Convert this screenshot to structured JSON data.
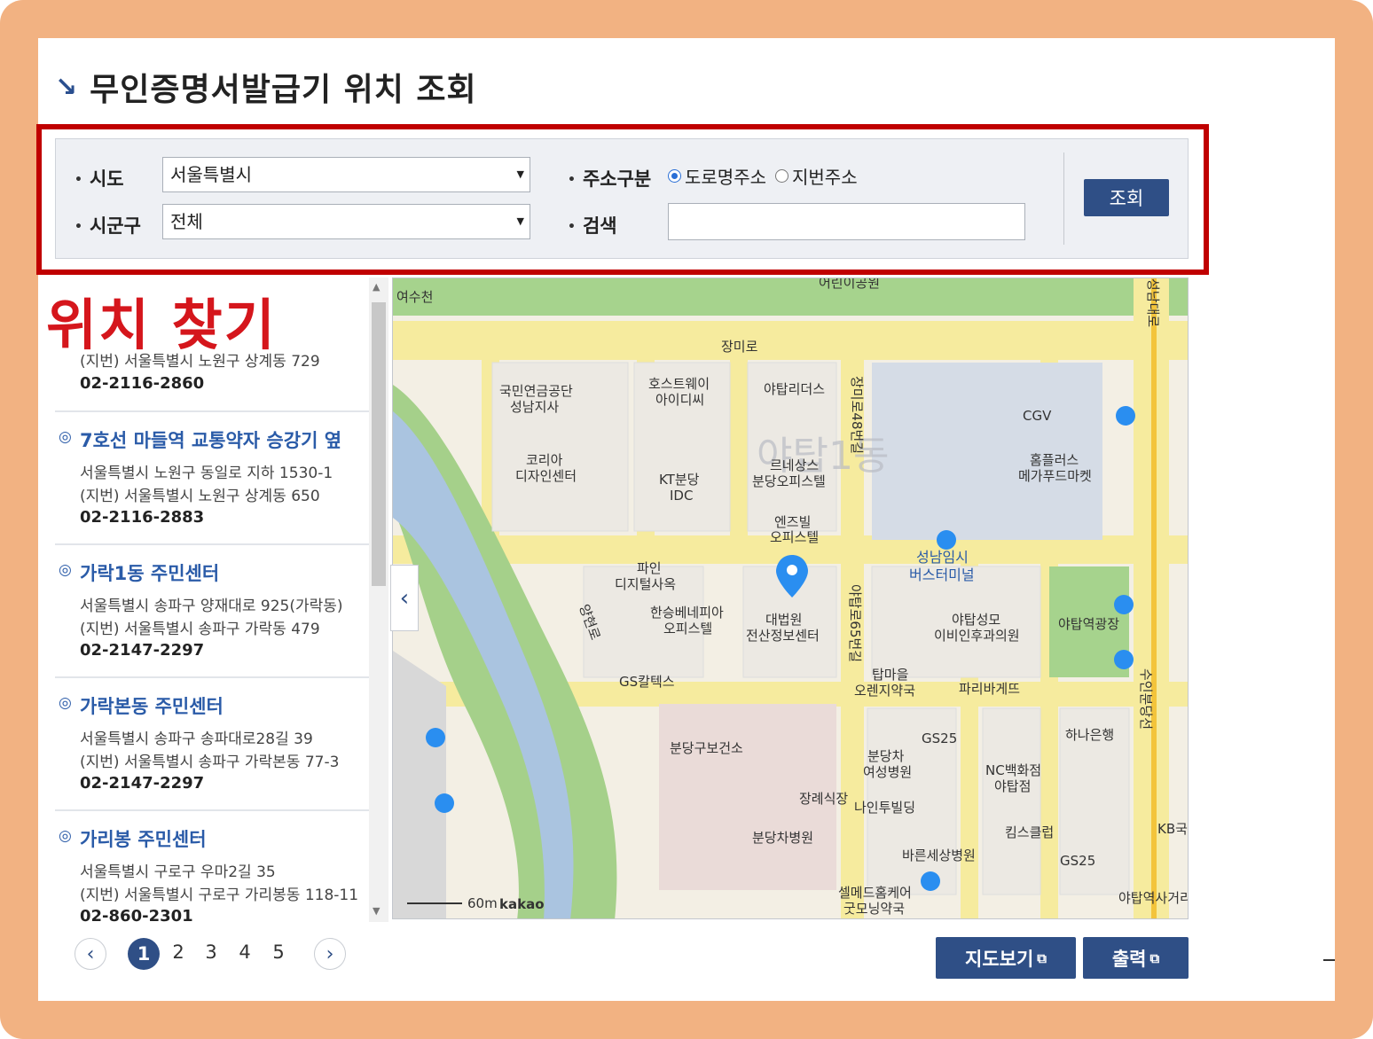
{
  "page": {
    "title": "무인증명서발급기 위치 조회",
    "overlay_label": "위치 찾기"
  },
  "search": {
    "sido_label": "시도",
    "sido_value": "서울특별시",
    "sigungu_label": "시군구",
    "sigungu_value": "전체",
    "address_type_label": "주소구분",
    "address_options": [
      "도로명주소",
      "지번주소"
    ],
    "selected_address_option": "도로명주소",
    "keyword_label": "검색",
    "keyword_value": "",
    "query_button": "조회"
  },
  "results": [
    {
      "name": "",
      "road": "",
      "jibun": "(지번) 서울특별시 노원구 상계동 729",
      "tel": "02-2116-2860"
    },
    {
      "name": "7호선 마들역 교통약자 승강기 옆",
      "road": "서울특별시 노원구 동일로 지하 1530-1",
      "jibun": "(지번) 서울특별시 노원구 상계동 650",
      "tel": "02-2116-2883"
    },
    {
      "name": "가락1동 주민센터",
      "road": "서울특별시 송파구 양재대로 925(가락동)",
      "jibun": "(지번) 서울특별시 송파구 가락동 479",
      "tel": "02-2147-2297"
    },
    {
      "name": "가락본동 주민센터",
      "road": "서울특별시 송파구 송파대로28길 39",
      "jibun": "(지번) 서울특별시 송파구 가락본동 77-3",
      "tel": "02-2147-2297"
    },
    {
      "name": "가리봉 주민센터",
      "road": "서울특별시 구로구 우마2길 35",
      "jibun": "(지번) 서울특별시 구로구 가리봉동 118-11",
      "tel": "02-860-2301"
    }
  ],
  "pagination": {
    "pages": [
      "1",
      "2",
      "3",
      "4",
      "5"
    ],
    "current": "1"
  },
  "map": {
    "scale": "60m",
    "brand": "kakao",
    "labels": {
      "yeosucheon": "여수천",
      "jangmiro": "장미로",
      "yatap1dong": "야탑1동",
      "nps1": "국민연금공단",
      "nps2": "성남지사",
      "host1": "호스트웨이",
      "host2": "아이디씨",
      "yatapriders": "야탑리더스",
      "cgv": "CGV",
      "homeplus1": "홈플러스",
      "homeplus2": "메가푸드마켓",
      "koreia1": "코리아",
      "koreia2": "디자인센터",
      "kt1": "KT분당",
      "kt2": "IDC",
      "reune1": "르네상스",
      "reune2": "분당오피스텔",
      "enz1": "엔즈빌",
      "enz2": "오피스텔",
      "bus1": "성남임시",
      "bus2": "버스터미널",
      "pine1": "파인",
      "pine2": "디지털사옥",
      "hanseung1": "한승베네피아",
      "hanseung2": "오피스텔",
      "court1": "대법원",
      "court2": "전산정보센터",
      "yatapsm1": "야탑성모",
      "yatapsm2": "이비인후과의원",
      "yatapsq": "야탑역광장",
      "gscaltex": "GS칼텍스",
      "tapmaeul1": "탑마을",
      "tapmaeul2": "오렌지약국",
      "paris": "파리바게뜨",
      "health": "분당구보건소",
      "gs25a": "GS25",
      "bundangcha1": "분당차",
      "bundangcha2": "여성병원",
      "nc1": "NC백화점",
      "nc2": "야탑점",
      "hana": "하나은행",
      "funeral": "장례식장",
      "naintu": "나인투빌딩",
      "kims": "킴스클럽",
      "chahospital": "분당차병원",
      "bareun": "바른세상병원",
      "gs25b": "GS25",
      "kb": "KB국",
      "selmed1": "셀메드홈케어",
      "selmed2": "굿모닝약국",
      "yatapstation": "야탑역사거리",
      "road48": "장미로48번길",
      "road65": "야탑로65번길",
      "yanghyunro": "양현로",
      "seongnam": "성남대로",
      "bundangline": "수인분당선",
      "park": "어린이공원"
    }
  },
  "buttons": {
    "map_view": "지도보기",
    "print": "출력",
    "ext_icon": "⧉"
  },
  "icons": {
    "prev": "‹",
    "next": "›",
    "collapse": "‹",
    "scroll_up": "▲",
    "scroll_down": "▼",
    "select_arrow": "▼",
    "title_mark": "↘",
    "pin": "◎"
  },
  "colors": {
    "brand": "#2f4f86",
    "highlight": "#c00000",
    "overlay": "#d5161c",
    "frame": "#f2b282"
  }
}
